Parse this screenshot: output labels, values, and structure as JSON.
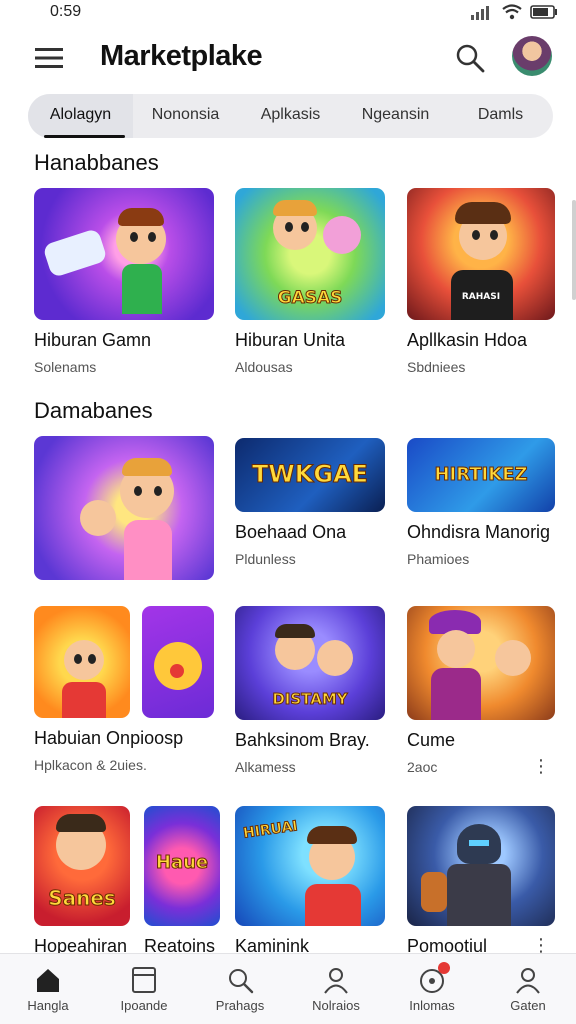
{
  "status_bar": {
    "time": "0:59"
  },
  "app_bar": {
    "title": "Marketplake"
  },
  "tabs": [
    {
      "label": "Alolagyn",
      "active": true
    },
    {
      "label": "Nononsia"
    },
    {
      "label": "Aplkasis"
    },
    {
      "label": "Ngeansin"
    },
    {
      "label": "Damls"
    }
  ],
  "sections": [
    {
      "title": "Hanabbanes",
      "cards": [
        {
          "title": "Hiburan Gamn",
          "subtitle": "Solenams"
        },
        {
          "title": "Hiburan Unita",
          "subtitle": "Aldousas",
          "badge": "GASAS"
        },
        {
          "title": "Apllkasin Hdoa",
          "subtitle": "Sbdniees",
          "badge": "RAHASI"
        }
      ]
    },
    {
      "title": "Damabanes",
      "cards": [
        {
          "title": "",
          "subtitle": ""
        },
        {
          "title": "Boehaad Ona",
          "subtitle": "Pldunless",
          "badge": "TWKGAE"
        },
        {
          "title": "Ohndisra Manorig",
          "subtitle": "Phamioes",
          "badge": "HIRTIKEZ"
        }
      ]
    },
    {
      "title": "",
      "cards": [
        {
          "title": "Habuian Onpioosp",
          "subtitle": "Hplkacon & 2uies."
        },
        {
          "title": "Bahksinom Bray.",
          "subtitle": "Alkamess",
          "badge": "DISTAMY"
        },
        {
          "title": "Cume",
          "subtitle": "2aoc"
        }
      ]
    },
    {
      "title": "",
      "cards": [
        {
          "title": "Hopeahiran",
          "subtitle": "",
          "badge": "Sanes"
        },
        {
          "title": "Reatoins",
          "subtitle": "",
          "badge": "Haue"
        },
        {
          "title": "Kaminink",
          "subtitle": "",
          "badge": "HIRUAI"
        },
        {
          "title": "Pomootiul",
          "subtitle": ""
        }
      ]
    }
  ],
  "bottom_nav": [
    {
      "label": "Hangla",
      "icon": "home-icon",
      "active": true
    },
    {
      "label": "Ipoande",
      "icon": "window-icon"
    },
    {
      "label": "Prahags",
      "icon": "search-icon"
    },
    {
      "label": "Nolraios",
      "icon": "person-icon"
    },
    {
      "label": "Inlomas",
      "icon": "notifications-icon",
      "has_dot": true
    },
    {
      "label": "Gaten",
      "icon": "profile-icon"
    }
  ],
  "colors": {
    "accent": "#111111",
    "tab_bg": "#ececef",
    "nav_bg": "#f8f8fa",
    "notification_dot": "#e53935"
  }
}
